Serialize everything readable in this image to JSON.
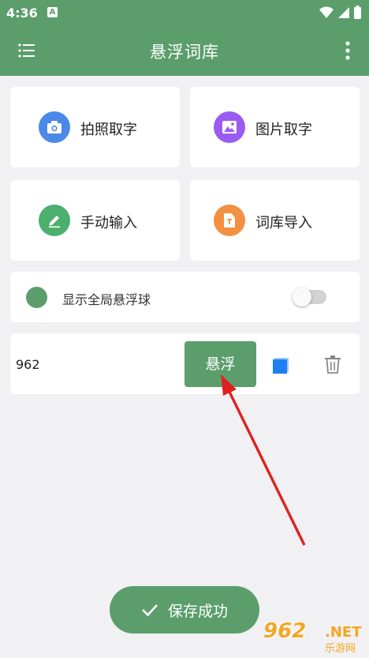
{
  "status": {
    "time": "4:36",
    "notif": "A"
  },
  "appbar": {
    "title": "悬浮词库",
    "menu_icon": "list-menu-icon",
    "more_icon": "more-vert-icon"
  },
  "tiles": [
    {
      "label": "拍照取字",
      "icon": "camera-icon",
      "color": "#4a89e8"
    },
    {
      "label": "图片取字",
      "icon": "image-icon",
      "color": "#9a5cf0"
    },
    {
      "label": "手动输入",
      "icon": "edit-icon",
      "color": "#4caf6e"
    },
    {
      "label": "词库导入",
      "icon": "file-import-icon",
      "color": "#f39042"
    }
  ],
  "global_toggle": {
    "label": "显示全局悬浮球",
    "enabled": false,
    "dot_color": "#5b9e6c"
  },
  "entry": {
    "word": "962",
    "float_label": "悬浮",
    "copy_color": "#1e7ff0",
    "delete_icon": "trash-icon"
  },
  "toast": {
    "text": "保存成功"
  },
  "watermark": {
    "brand": "962",
    "domain": ".NET",
    "site": "乐游网"
  },
  "colors": {
    "primary": "#5b9e6c",
    "arrow": "#e02020"
  }
}
